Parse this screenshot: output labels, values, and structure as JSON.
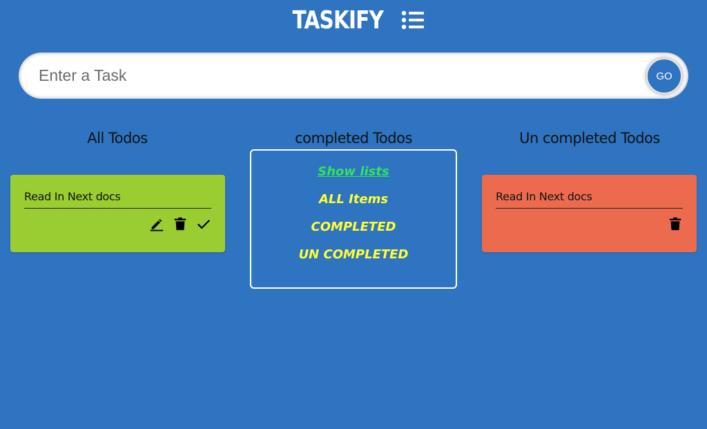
{
  "header": {
    "title": "TASKIFY",
    "icon": "list-icon"
  },
  "search": {
    "placeholder": "Enter a Task",
    "value": "",
    "go_label": "GO"
  },
  "columns": {
    "all": {
      "heading": "All Todos"
    },
    "completed": {
      "heading": "completed Todos"
    },
    "uncompleted": {
      "heading": "Un completed Todos"
    }
  },
  "all_todos": [
    {
      "text": "Read In Next docs",
      "actions": [
        "edit-icon",
        "trash-icon",
        "check-icon"
      ]
    }
  ],
  "uncompleted_todos": [
    {
      "text": "Read In Next docs",
      "actions": [
        "trash-icon"
      ]
    }
  ],
  "menu": {
    "title": "Show lists",
    "items": [
      "ALL Items",
      "COMPLETED",
      "UN COMPLETED"
    ]
  },
  "colors": {
    "background": "#2f74c0",
    "all_card": "#9acd32",
    "uncompleted_card": "#ec6b4f",
    "menu_title": "#2ee65a",
    "menu_item": "#ffff33"
  }
}
